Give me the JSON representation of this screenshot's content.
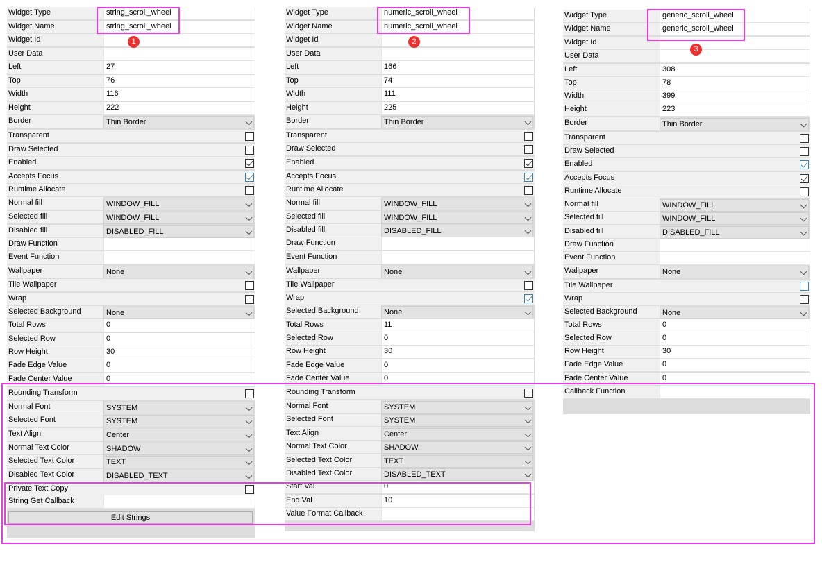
{
  "panels": [
    {
      "id": "p1",
      "rows": [
        {
          "label": "Widget Type",
          "kind": "text",
          "value": "string_scroll_wheel"
        },
        {
          "label": "Widget Name",
          "kind": "text",
          "value": "string_scroll_wheel"
        },
        {
          "label": "Widget Id",
          "kind": "text",
          "value": ""
        },
        {
          "label": "User Data",
          "kind": "text",
          "value": ""
        },
        {
          "label": "Left",
          "kind": "text",
          "value": "27"
        },
        {
          "label": "Top",
          "kind": "text",
          "value": "76"
        },
        {
          "label": "Width",
          "kind": "text",
          "value": "116"
        },
        {
          "label": "Height",
          "kind": "text",
          "value": "222"
        },
        {
          "label": "Border",
          "kind": "dropdown",
          "value": "Thin Border"
        },
        {
          "label": "Transparent",
          "kind": "check",
          "checked": false
        },
        {
          "label": "Draw Selected",
          "kind": "check",
          "checked": false
        },
        {
          "label": "Enabled",
          "kind": "check",
          "checked": true
        },
        {
          "label": "Accepts Focus",
          "kind": "check",
          "checked": true,
          "focused": true
        },
        {
          "label": "Runtime Allocate",
          "kind": "check",
          "checked": false
        },
        {
          "label": "Normal fill",
          "kind": "dropdown",
          "value": "WINDOW_FILL"
        },
        {
          "label": "Selected fill",
          "kind": "dropdown",
          "value": "WINDOW_FILL"
        },
        {
          "label": "Disabled fill",
          "kind": "dropdown",
          "value": "DISABLED_FILL"
        },
        {
          "label": "Draw Function",
          "kind": "text",
          "value": ""
        },
        {
          "label": "Event Function",
          "kind": "text",
          "value": ""
        },
        {
          "label": "Wallpaper",
          "kind": "dropdown",
          "value": "None"
        },
        {
          "label": "Tile Wallpaper",
          "kind": "check",
          "checked": false
        },
        {
          "label": "Wrap",
          "kind": "check",
          "checked": false
        },
        {
          "label": "Selected Background",
          "kind": "dropdown",
          "value": "None"
        },
        {
          "label": "Total Rows",
          "kind": "text",
          "value": "0"
        },
        {
          "label": "Selected Row",
          "kind": "text",
          "value": "0"
        },
        {
          "label": "Row Height",
          "kind": "text",
          "value": "30"
        },
        {
          "label": "Fade Edge Value",
          "kind": "text",
          "value": "0"
        },
        {
          "label": "Fade Center Value",
          "kind": "text",
          "value": "0"
        },
        {
          "label": "Rounding Transform",
          "kind": "check",
          "checked": false
        },
        {
          "label": "Normal Font",
          "kind": "dropdown",
          "value": "SYSTEM"
        },
        {
          "label": "Selected Font",
          "kind": "dropdown",
          "value": "SYSTEM"
        },
        {
          "label": "Text Align",
          "kind": "dropdown",
          "value": "Center"
        },
        {
          "label": "Normal Text Color",
          "kind": "dropdown",
          "value": "SHADOW"
        },
        {
          "label": "Selected Text Color",
          "kind": "dropdown",
          "value": "TEXT"
        },
        {
          "label": "Disabled Text Color",
          "kind": "dropdown",
          "value": "DISABLED_TEXT"
        },
        {
          "label": "Private Text Copy",
          "kind": "check",
          "checked": false
        },
        {
          "label": "String Get Callback",
          "kind": "text",
          "value": ""
        }
      ],
      "button": "Edit Strings",
      "badge": "1"
    },
    {
      "id": "p2",
      "rows": [
        {
          "label": "Widget Type",
          "kind": "text",
          "value": "numeric_scroll_wheel"
        },
        {
          "label": "Widget Name",
          "kind": "text",
          "value": "numeric_scroll_wheel"
        },
        {
          "label": "Widget Id",
          "kind": "text",
          "value": ""
        },
        {
          "label": "User Data",
          "kind": "text",
          "value": ""
        },
        {
          "label": "Left",
          "kind": "text",
          "value": "166"
        },
        {
          "label": "Top",
          "kind": "text",
          "value": "74"
        },
        {
          "label": "Width",
          "kind": "text",
          "value": "111"
        },
        {
          "label": "Height",
          "kind": "text",
          "value": "225"
        },
        {
          "label": "Border",
          "kind": "dropdown",
          "value": "Thin Border"
        },
        {
          "label": "Transparent",
          "kind": "check",
          "checked": false
        },
        {
          "label": "Draw Selected",
          "kind": "check",
          "checked": false
        },
        {
          "label": "Enabled",
          "kind": "check",
          "checked": true
        },
        {
          "label": "Accepts Focus",
          "kind": "check",
          "checked": true,
          "focused": true
        },
        {
          "label": "Runtime Allocate",
          "kind": "check",
          "checked": false
        },
        {
          "label": "Normal fill",
          "kind": "dropdown",
          "value": "WINDOW_FILL"
        },
        {
          "label": "Selected fill",
          "kind": "dropdown",
          "value": "WINDOW_FILL"
        },
        {
          "label": "Disabled fill",
          "kind": "dropdown",
          "value": "DISABLED_FILL"
        },
        {
          "label": "Draw Function",
          "kind": "text",
          "value": ""
        },
        {
          "label": "Event Function",
          "kind": "text",
          "value": ""
        },
        {
          "label": "Wallpaper",
          "kind": "dropdown",
          "value": "None"
        },
        {
          "label": "Tile Wallpaper",
          "kind": "check",
          "checked": false
        },
        {
          "label": "Wrap",
          "kind": "check",
          "checked": true,
          "focused": true
        },
        {
          "label": "Selected Background",
          "kind": "dropdown",
          "value": "None"
        },
        {
          "label": "Total Rows",
          "kind": "text",
          "value": "11"
        },
        {
          "label": "Selected Row",
          "kind": "text",
          "value": "0"
        },
        {
          "label": "Row Height",
          "kind": "text",
          "value": "30"
        },
        {
          "label": "Fade Edge Value",
          "kind": "text",
          "value": "0"
        },
        {
          "label": "Fade Center Value",
          "kind": "text",
          "value": "0"
        },
        {
          "label": "Rounding Transform",
          "kind": "check",
          "checked": false
        },
        {
          "label": "Normal Font",
          "kind": "dropdown",
          "value": "SYSTEM"
        },
        {
          "label": "Selected Font",
          "kind": "dropdown",
          "value": "SYSTEM"
        },
        {
          "label": "Text Align",
          "kind": "dropdown",
          "value": "Center"
        },
        {
          "label": "Normal Text Color",
          "kind": "dropdown",
          "value": "SHADOW"
        },
        {
          "label": "Selected Text Color",
          "kind": "dropdown",
          "value": "TEXT"
        },
        {
          "label": "Disabled Text Color",
          "kind": "dropdown",
          "value": "DISABLED_TEXT"
        },
        {
          "label": "Start Val",
          "kind": "text",
          "value": "0"
        },
        {
          "label": "End Val",
          "kind": "text",
          "value": "10"
        },
        {
          "label": "Value Format Callback",
          "kind": "text",
          "value": ""
        }
      ],
      "badge": "2"
    },
    {
      "id": "p3",
      "rows": [
        {
          "label": "Widget Type",
          "kind": "text",
          "value": "generic_scroll_wheel"
        },
        {
          "label": "Widget Name",
          "kind": "text",
          "value": "generic_scroll_wheel"
        },
        {
          "label": "Widget Id",
          "kind": "text",
          "value": ""
        },
        {
          "label": "User Data",
          "kind": "text",
          "value": ""
        },
        {
          "label": "Left",
          "kind": "text",
          "value": "308"
        },
        {
          "label": "Top",
          "kind": "text",
          "value": "78"
        },
        {
          "label": "Width",
          "kind": "text",
          "value": "399"
        },
        {
          "label": "Height",
          "kind": "text",
          "value": "223"
        },
        {
          "label": "Border",
          "kind": "dropdown",
          "value": "Thin Border"
        },
        {
          "label": "Transparent",
          "kind": "check",
          "checked": false
        },
        {
          "label": "Draw Selected",
          "kind": "check",
          "checked": false
        },
        {
          "label": "Enabled",
          "kind": "check",
          "checked": true,
          "focused": true
        },
        {
          "label": "Accepts Focus",
          "kind": "check",
          "checked": true
        },
        {
          "label": "Runtime Allocate",
          "kind": "check",
          "checked": false
        },
        {
          "label": "Normal fill",
          "kind": "dropdown",
          "value": "WINDOW_FILL"
        },
        {
          "label": "Selected fill",
          "kind": "dropdown",
          "value": "WINDOW_FILL"
        },
        {
          "label": "Disabled fill",
          "kind": "dropdown",
          "value": "DISABLED_FILL"
        },
        {
          "label": "Draw Function",
          "kind": "text",
          "value": ""
        },
        {
          "label": "Event Function",
          "kind": "text",
          "value": ""
        },
        {
          "label": "Wallpaper",
          "kind": "dropdown",
          "value": "None"
        },
        {
          "label": "Tile Wallpaper",
          "kind": "check",
          "checked": false,
          "focused": true
        },
        {
          "label": "Wrap",
          "kind": "check",
          "checked": false
        },
        {
          "label": "Selected Background",
          "kind": "dropdown",
          "value": "None"
        },
        {
          "label": "Total Rows",
          "kind": "text",
          "value": "0"
        },
        {
          "label": "Selected Row",
          "kind": "text",
          "value": "0"
        },
        {
          "label": "Row Height",
          "kind": "text",
          "value": "30"
        },
        {
          "label": "Fade Edge Value",
          "kind": "text",
          "value": "0"
        },
        {
          "label": "Fade Center Value",
          "kind": "text",
          "value": "0"
        },
        {
          "label": "Callback Function",
          "kind": "text",
          "value": ""
        }
      ],
      "badge": "3"
    }
  ],
  "colors": {
    "highlight": "#e83de0",
    "badge": "#ec2f2f",
    "focus_checkbox": "#3c7fb1"
  }
}
